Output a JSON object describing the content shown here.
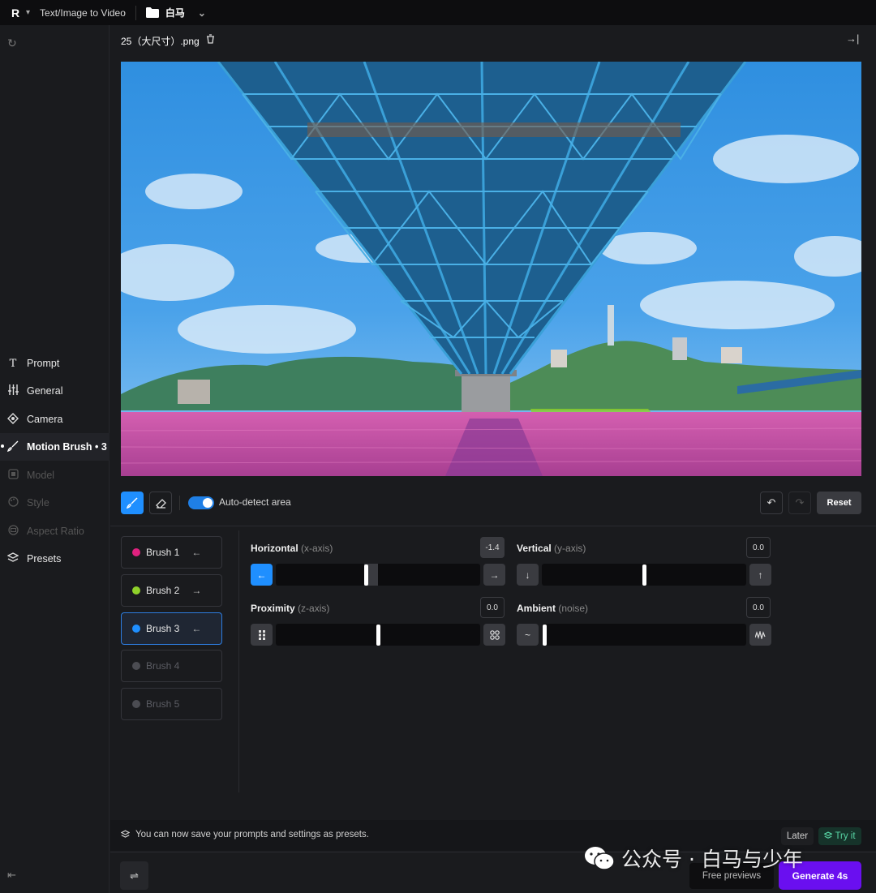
{
  "topbar": {
    "logo": "R",
    "breadcrumb": "Text/Image to Video",
    "folder": "白马"
  },
  "sidebar": {
    "items": [
      {
        "label": "Prompt",
        "icon": "text-icon",
        "state": "normal"
      },
      {
        "label": "General",
        "icon": "sliders-icon",
        "state": "normal"
      },
      {
        "label": "Camera",
        "icon": "camera-icon",
        "state": "normal"
      },
      {
        "label": "Motion Brush • 3",
        "icon": "brush-icon",
        "state": "active"
      },
      {
        "label": "Model",
        "icon": "chip-icon",
        "state": "disabled"
      },
      {
        "label": "Style",
        "icon": "palette-icon",
        "state": "disabled"
      },
      {
        "label": "Aspect Ratio",
        "icon": "aspect-icon",
        "state": "disabled"
      },
      {
        "label": "Presets",
        "icon": "layers-icon",
        "state": "normal"
      }
    ]
  },
  "file": {
    "name": "25（大尺寸）.png"
  },
  "tools": {
    "auto_detect_label": "Auto-detect area",
    "auto_detect_on": true,
    "reset_label": "Reset"
  },
  "brushes": [
    {
      "label": "Brush 1",
      "color": "#e0217f",
      "arrow": "←",
      "state": "normal"
    },
    {
      "label": "Brush 2",
      "color": "#8fd12a",
      "arrow": "→",
      "state": "normal"
    },
    {
      "label": "Brush 3",
      "color": "#1f8fff",
      "arrow": "←",
      "state": "active"
    },
    {
      "label": "Brush 4",
      "color": "#4b4c52",
      "arrow": "",
      "state": "off"
    },
    {
      "label": "Brush 5",
      "color": "#4b4c52",
      "arrow": "",
      "state": "off"
    }
  ],
  "controls": {
    "horizontal": {
      "title": "Horizontal",
      "axis": "(x-axis)",
      "value": "-1.4",
      "level": 0.44
    },
    "vertical": {
      "title": "Vertical",
      "axis": "(y-axis)",
      "value": "0.0",
      "level": 0.5
    },
    "proximity": {
      "title": "Proximity",
      "axis": "(z-axis)",
      "value": "0.0",
      "level": 0.5
    },
    "ambient": {
      "title": "Ambient",
      "axis": "(noise)",
      "value": "0.0",
      "level": 0.0
    }
  },
  "notice": {
    "text": "You can now save your prompts and settings as presets.",
    "later": "Later",
    "try": "Try it"
  },
  "footer": {
    "free_previews": "Free previews",
    "generate": "Generate 4s"
  },
  "watermark": {
    "text": "公众号 · 白马与少年"
  },
  "colors": {
    "accent_blue": "#1f8fff",
    "generate_purple": "#6a0ff0",
    "brush1_mask": "#d94fa6",
    "brush2_mask": "#8fd12a"
  }
}
